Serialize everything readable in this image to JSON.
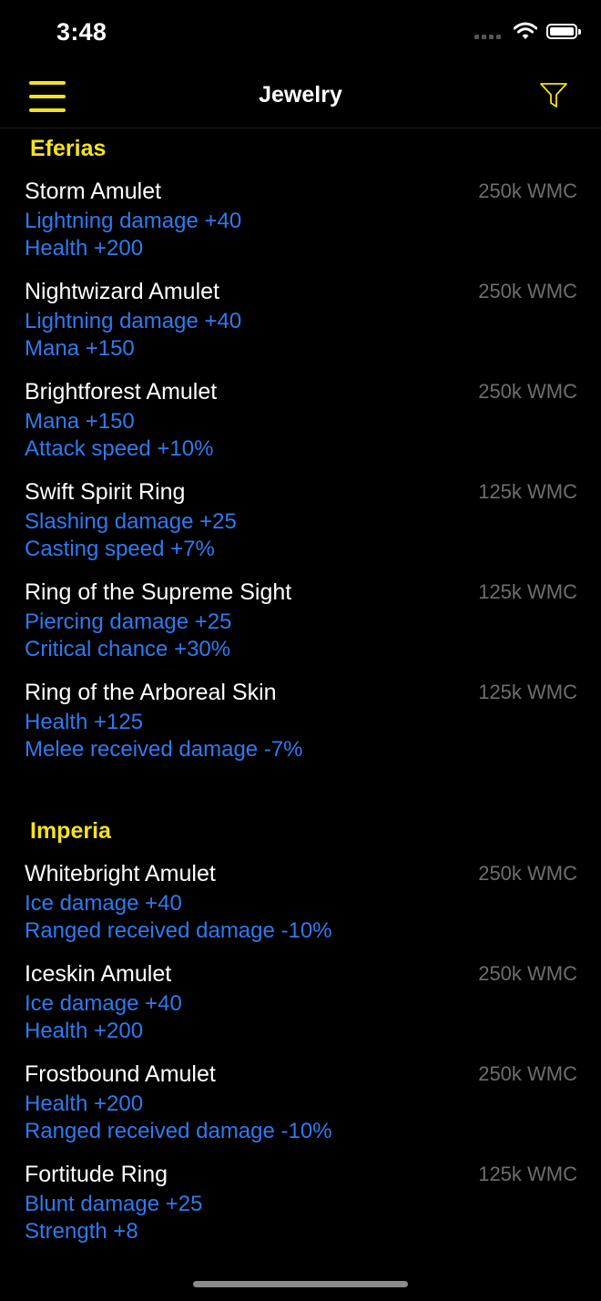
{
  "status": {
    "time": "3:48"
  },
  "nav": {
    "title": "Jewelry"
  },
  "sections": [
    {
      "title": "Eferias",
      "items": [
        {
          "name": "Storm Amulet",
          "price": "250k WMC",
          "stats": [
            "Lightning damage +40",
            "Health +200"
          ]
        },
        {
          "name": "Nightwizard Amulet",
          "price": "250k WMC",
          "stats": [
            "Lightning damage +40",
            "Mana +150"
          ]
        },
        {
          "name": "Brightforest Amulet",
          "price": "250k WMC",
          "stats": [
            "Mana +150",
            "Attack speed +10%"
          ]
        },
        {
          "name": "Swift Spirit Ring",
          "price": "125k WMC",
          "stats": [
            "Slashing damage +25",
            "Casting speed +7%"
          ]
        },
        {
          "name": "Ring of the Supreme Sight",
          "price": "125k WMC",
          "stats": [
            "Piercing damage +25",
            "Critical chance +30%"
          ]
        },
        {
          "name": "Ring of the Arboreal Skin",
          "price": "125k WMC",
          "stats": [
            "Health +125",
            "Melee received damage -7%"
          ]
        }
      ]
    },
    {
      "title": "Imperia",
      "items": [
        {
          "name": "Whitebright Amulet",
          "price": "250k WMC",
          "stats": [
            "Ice damage +40",
            "Ranged received damage -10%"
          ]
        },
        {
          "name": "Iceskin Amulet",
          "price": "250k WMC",
          "stats": [
            "Ice damage +40",
            "Health +200"
          ]
        },
        {
          "name": "Frostbound Amulet",
          "price": "250k WMC",
          "stats": [
            "Health +200",
            "Ranged received damage -10%"
          ]
        },
        {
          "name": "Fortitude Ring",
          "price": "125k WMC",
          "stats": [
            "Blunt damage +25",
            "Strength +8"
          ]
        }
      ]
    }
  ],
  "colors": {
    "accent": "#f5e31a",
    "stat": "#2f7af0",
    "price": "#6e6e6e",
    "background": "#000000"
  },
  "icons": {
    "menu": "hamburger-icon",
    "filter": "filter-funnel-icon",
    "wifi": "wifi-icon",
    "battery": "battery-icon",
    "signal": "cellular-signal-icon"
  }
}
